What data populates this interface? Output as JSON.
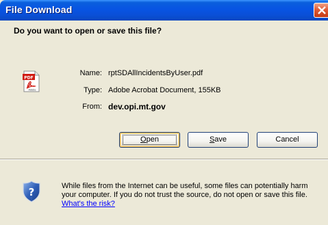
{
  "window": {
    "title": "File Download"
  },
  "question": "Do you want to open or save this file?",
  "file": {
    "icon": "pdf-file-icon",
    "name_label": "Name:",
    "name_value": "rptSDAllIncidentsByUser.pdf",
    "type_label": "Type:",
    "type_value": "Adobe Acrobat Document, 155KB",
    "from_label": "From:",
    "from_value": "dev.opi.mt.gov"
  },
  "buttons": {
    "open_accel": "O",
    "open_rest": "pen",
    "save_accel": "S",
    "save_rest": "ave",
    "cancel": "Cancel"
  },
  "warning": {
    "icon": "shield-question-icon",
    "text": "While files from the Internet can be useful, some files can potentially harm your computer. If you do not trust the source, do not open or save this file. ",
    "link": "What's the risk?"
  },
  "colors": {
    "titlebar": "#0854e3",
    "background": "#ece9d8",
    "close_button": "#e05b36",
    "link": "#0000ff"
  }
}
